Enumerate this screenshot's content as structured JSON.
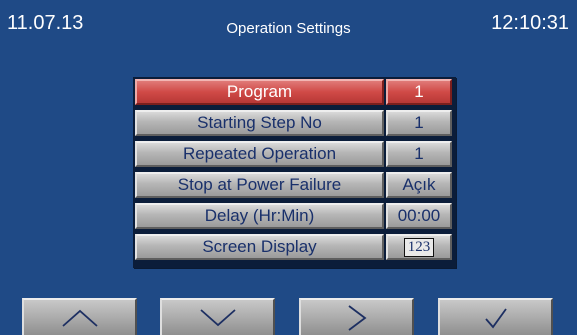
{
  "header": {
    "date": "11.07.13",
    "title": "Operation Settings",
    "time": "12:10:31"
  },
  "settings": [
    {
      "label": "Program",
      "value": "1",
      "selected": true
    },
    {
      "label": "Starting Step No",
      "value": "1",
      "selected": false
    },
    {
      "label": "Repeated Operation",
      "value": "1",
      "selected": false
    },
    {
      "label": "Stop at Power Failure",
      "value": "Açık",
      "selected": false
    },
    {
      "label": "Delay (Hr:Min)",
      "value": "00:00",
      "selected": false
    },
    {
      "label": "Screen Display",
      "value": "123",
      "selected": false
    }
  ],
  "nav": {
    "up_icon": "chevron-up-icon",
    "down_icon": "chevron-down-icon",
    "next_icon": "chevron-right-icon",
    "confirm_icon": "check-icon"
  },
  "colors": {
    "screen_bg": "#1f4a86",
    "selected_row": "#d04a47",
    "button_gray": "#b5b5b5",
    "text_dark_blue": "#19306b"
  }
}
